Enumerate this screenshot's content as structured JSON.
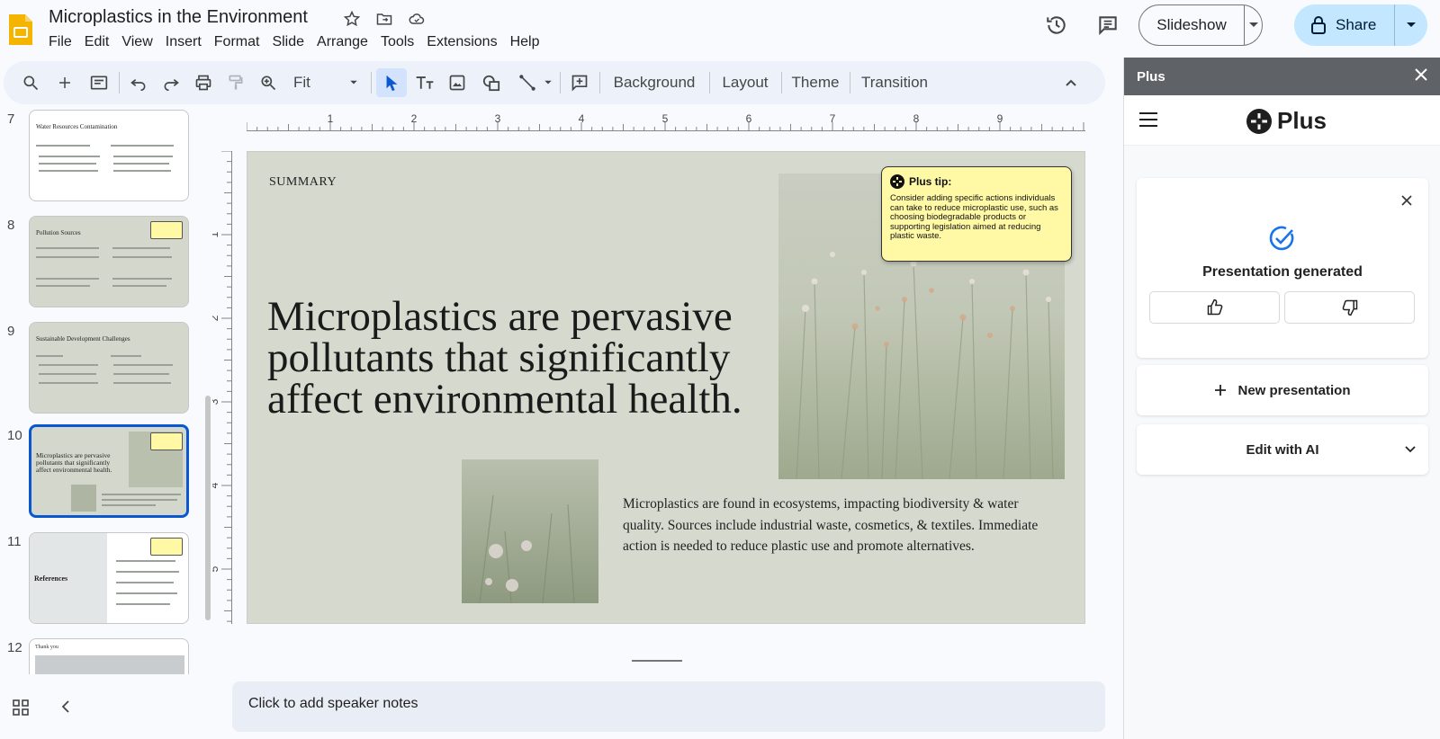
{
  "doc": {
    "title": "Microplastics in the Environment"
  },
  "menu": [
    "File",
    "Edit",
    "View",
    "Insert",
    "Format",
    "Slide",
    "Arrange",
    "Tools",
    "Extensions",
    "Help"
  ],
  "header": {
    "slideshow_label": "Slideshow",
    "share_label": "Share"
  },
  "toolbar": {
    "zoom_label": "Fit",
    "background": "Background",
    "layout": "Layout",
    "theme": "Theme",
    "transition": "Transition"
  },
  "filmstrip": {
    "slides": [
      {
        "number": "7",
        "title": "Water Resources Contamination"
      },
      {
        "number": "8",
        "title": "Pollution Sources"
      },
      {
        "number": "9",
        "title": "Sustainable Development Challenges"
      },
      {
        "number": "10",
        "title": "Microplastics are pervasive pollutants that significantly affect environmental health."
      },
      {
        "number": "11",
        "title": "References"
      },
      {
        "number": "12",
        "title": "Thank you"
      }
    ],
    "selected": "10"
  },
  "ruler": {
    "h_labels": [
      "1",
      "2",
      "3",
      "4",
      "5",
      "6",
      "7",
      "8",
      "9"
    ],
    "v_labels": [
      "1",
      "2",
      "3",
      "4",
      "5"
    ]
  },
  "slide": {
    "label": "SUMMARY",
    "headline": "Microplastics are pervasive pollutants that significantly affect environmental health.",
    "body": "Microplastics are found in ecosystems, impacting biodiversity & water quality. Sources include industrial waste, cosmetics, & textiles. Immediate action is needed to reduce plastic use and promote alternatives.",
    "tip_title": "Plus tip:",
    "tip_body": "Consider adding specific actions individuals can take to reduce microplastic use, such as choosing biodegradable products or supporting legislation aimed at reducing plastic waste."
  },
  "notes": {
    "placeholder": "Click to add speaker notes"
  },
  "panel": {
    "header_title": "Plus",
    "logo_text": "Plus",
    "generated_text": "Presentation generated",
    "new_presentation": "New presentation",
    "edit_with_ai": "Edit with AI"
  },
  "colors": {
    "accent": "#0b57d0",
    "share_bg": "#c2e7ff",
    "slide_bg": "#d6d9ce",
    "tip_bg": "#fff9a6"
  }
}
